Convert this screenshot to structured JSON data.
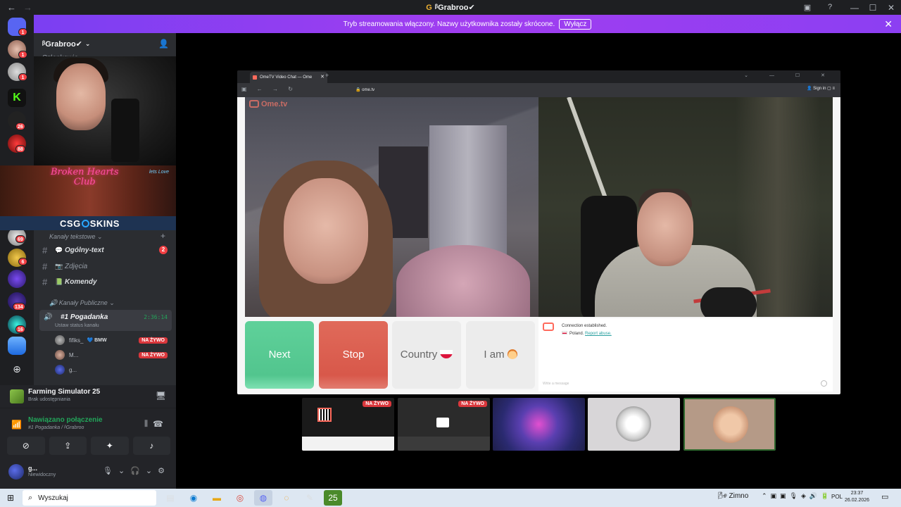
{
  "titlebar": {
    "title": "ᵝGrabroo✔",
    "nav_back": "←",
    "nav_forward": "→"
  },
  "banner": {
    "text": "Tryb streamowania włączony. Nazwy użytkownika zostały skrócone.",
    "button": "Wyłącz"
  },
  "rail": {
    "badges": [
      "1",
      "1",
      "1",
      "26",
      "88",
      "69",
      "6",
      "134",
      "16"
    ]
  },
  "server": {
    "name": "ᵝGrabroo✔",
    "members_label": "Członkowie"
  },
  "promo": {
    "neon_line1": "Broken Hearts",
    "neon_line2": "Club",
    "neon_side": "lets\nLove",
    "brand": "CSG SKINS"
  },
  "channels": {
    "category_text": "Kanały tekstowe",
    "category_public": "Kanały Publiczne",
    "text_channels": [
      {
        "name": "Ogólny-text",
        "badge": "2"
      },
      {
        "name": "Zdjęcia"
      },
      {
        "name": "Komendy"
      }
    ],
    "voice_channel": {
      "name": "#1 Pogadanka",
      "time": "2:36:14",
      "status_placeholder": "Ustaw status kanału"
    },
    "voice_users": [
      {
        "name": "fifiks_",
        "tag": "BMW",
        "live": "NA ŻYWO"
      },
      {
        "name": "M...",
        "live": "NA ŻYWO"
      },
      {
        "name": "g..."
      }
    ]
  },
  "activity": {
    "game": "Farming Simulator 25",
    "status": "Brak udostępniania"
  },
  "voice_panel": {
    "connected": "Nawiązano połączenie",
    "location": "#1 Pogadanka / ᵝGrabroo"
  },
  "user": {
    "name": "g...",
    "status": "Niewidoczny"
  },
  "browser": {
    "tab_title": "OmeTV Video Chat — Ome",
    "url": "ome.tv",
    "sign_in": "Sign in",
    "logo": "Ome.tv"
  },
  "ometv": {
    "next": "Next",
    "stop": "Stop",
    "country": "Country",
    "iam": "I am",
    "connection_msg": "Connection established.",
    "country_msg": "Poland.",
    "report": "Report abuse.",
    "input_placeholder": "Write a message"
  },
  "thumbnails": {
    "live_label": "NA ŻYWO"
  },
  "taskbar": {
    "search": "Wyszukaj",
    "weather": "Zimno",
    "lang": "POL",
    "time": "23:37",
    "date": "26.02.2026"
  }
}
